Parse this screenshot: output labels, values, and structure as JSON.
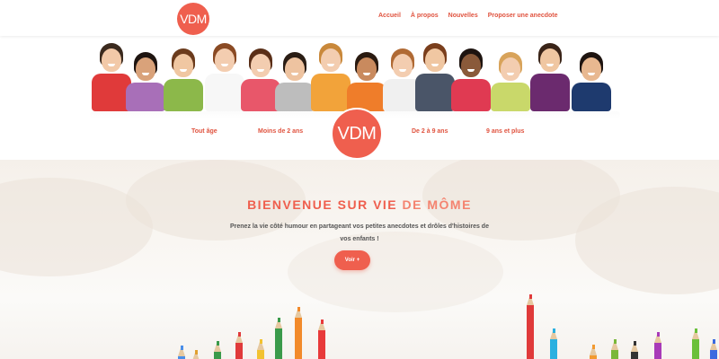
{
  "header": {
    "logo_text": "VDM",
    "nav": [
      "Accueil",
      "À propos",
      "Nouvelles",
      "Proposer une anecdote"
    ]
  },
  "categories": {
    "all_ages": "Tout âge",
    "under_2": "Moins de 2 ans",
    "center_logo": "VDM",
    "two_to_nine": "De 2 à 9 ans",
    "nine_plus": "9 ans et plus"
  },
  "hero": {
    "title_part1": "BIENVENUE SUR VIE ",
    "title_part2": "DE MÔME",
    "subtitle": "Prenez la vie côté humour en partageant vos petites anecdotes et drôles d'histoires de vos enfants !",
    "cta": "Voir +"
  },
  "colors": {
    "accent": "#ef5f4e",
    "nav": "#e0533f"
  }
}
